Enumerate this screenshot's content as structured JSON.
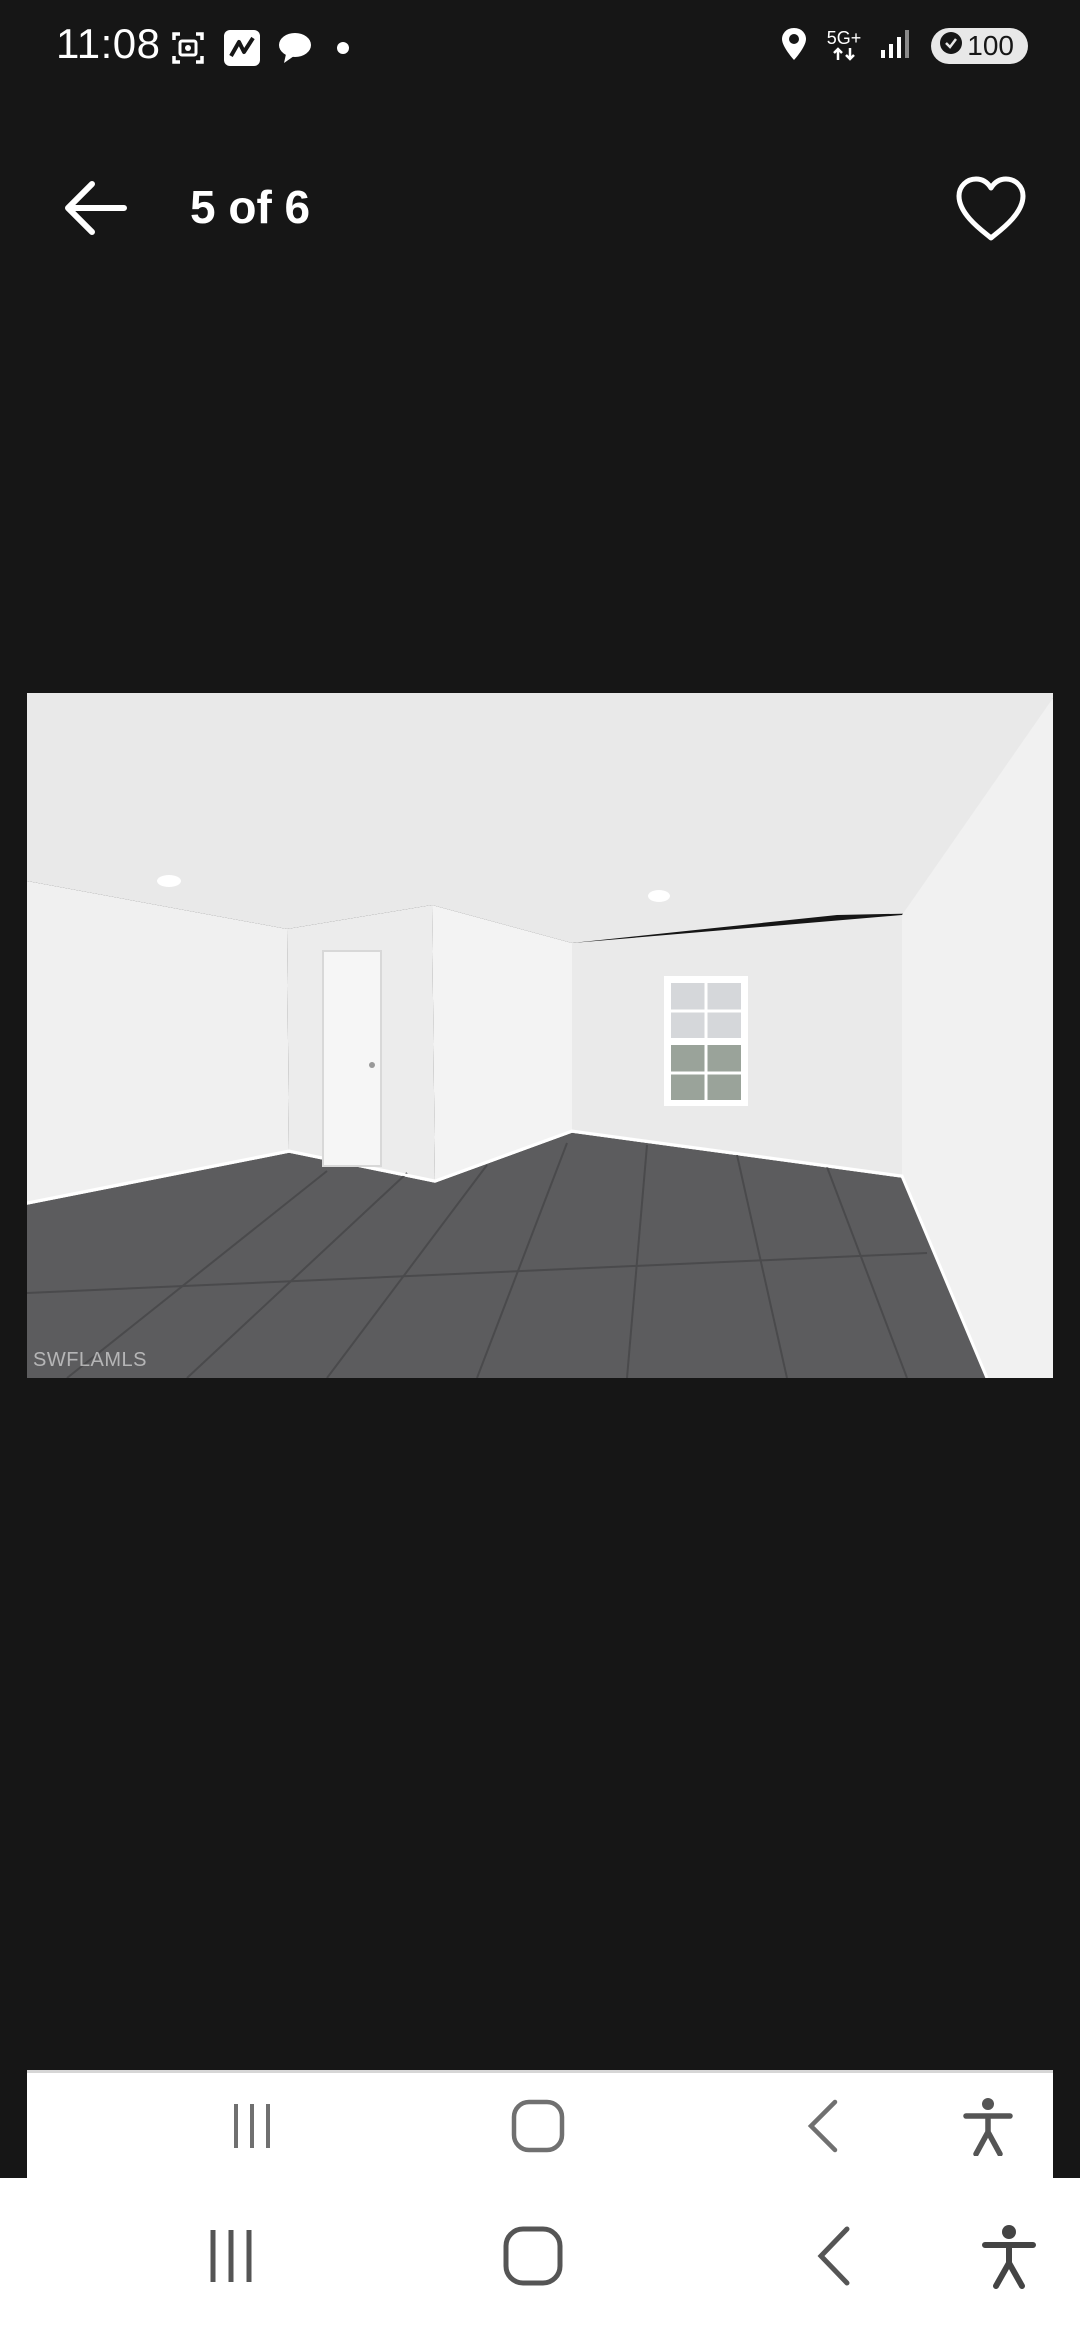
{
  "status_bar": {
    "time": "11:08",
    "network": "5G+",
    "battery": "100",
    "left_icons": [
      "screenshot-icon",
      "app-notification-icon",
      "chat-bubble-icon",
      "dot-icon"
    ],
    "right_icons": [
      "location-icon",
      "network-5g-icon",
      "signal-icon",
      "battery-icon"
    ]
  },
  "header": {
    "counter": "5 of 6",
    "back_icon": "back-arrow-icon",
    "favorite_icon": "heart-outline-icon"
  },
  "photo": {
    "watermark": "SWFLAMLS",
    "subject": "empty-room-interior"
  },
  "inner_nav": {
    "buttons": [
      "recent-apps-icon",
      "home-icon",
      "back-icon",
      "accessibility-icon"
    ]
  },
  "system_nav": {
    "buttons": [
      "recent-apps-icon",
      "home-icon",
      "back-icon",
      "accessibility-icon"
    ]
  },
  "colors": {
    "background": "#161616",
    "nav_background": "#ffffff",
    "nav_icon": "#555555"
  }
}
